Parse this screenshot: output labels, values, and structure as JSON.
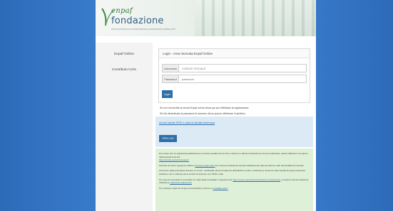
{
  "header": {
    "logo_name": "enpaf",
    "logo_fond": "fondazione",
    "logo_sub": "ENTE NAZIONALE DI PREVIDENZA E ASSISTENZA FARMACISTI"
  },
  "sidebar": {
    "items": [
      {
        "label": "Enpaf Online"
      },
      {
        "label": "Contributo 0,5%"
      }
    ]
  },
  "login": {
    "title": "Login - Area riservata Enpaf Online",
    "username_label": "Username",
    "username_placeholder": "CODICE FISCALE",
    "password_label": "Password",
    "password_placeholder": "password",
    "submit_label": "login"
  },
  "info": {
    "line1": "Se non sei iscritto ai servizi Enpaf online clicca qui per effettuare la registrazione.",
    "line2": "Se hai dimenticato la password di accesso clicca qui per effettuare il ripristino."
  },
  "spid": {
    "link_text": "Accedi tramite SPID o carta di identità elettronica",
    "button_label": "SPID-CIE"
  },
  "notice": {
    "p1": "Per coloro che la registrazione/attivazione non fosse andata a buon fine o fossero in attesa di attivazione di una credenziale, potete effettuare il recupero della password al link",
    "p1_link": "https://portal.enpaf.it/recupero/",
    "p2_pre": "Scrivete al nostro seguente indirizzo",
    "p2_link": "assistenza@enpaf.it",
    "p2_post": "per ricevere assistenza tecnica relativamente alla procedura e alle funzionalità del servizio.",
    "p3": "Al termine della procedura cliccare su \"Invia\", verificando prima l'esattezza dell'indirizzo email e verificare la ricezione nella casella di posta elettronica indicata e che il mittente sia il servizio di accesso con SPID o CIE.",
    "p4_pre": "Per ogni di necessità di consultare le credenziali consultate il seguente link",
    "p4_link": "https://www.enpaf.it/amministrazione-trasparente",
    "p4_post": "e inviare la documentazione richiesta a",
    "p4_link2": "registrazione@enpaf.it",
    "p5_pre": "Per chiedere supporto di tipo amministrativo scrivere a",
    "p5_link": "enpaf@enpaf.it"
  },
  "colors": {
    "background": "#3b7fd0",
    "accent": "#2f6fa8",
    "spid_bg": "#dceaf6",
    "notice_bg": "#dff0d8"
  }
}
